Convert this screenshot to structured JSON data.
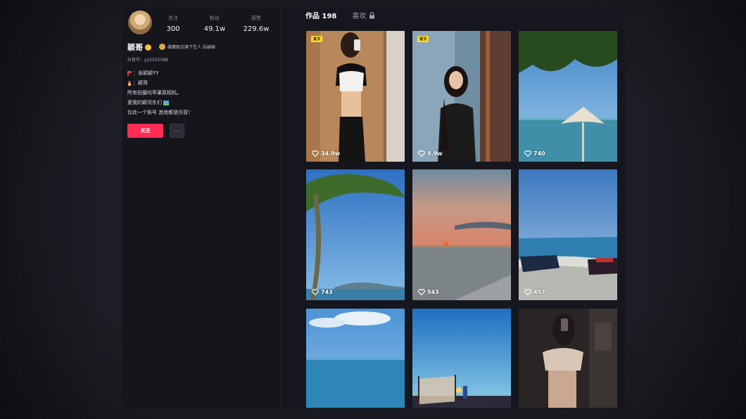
{
  "profile": {
    "stats": [
      {
        "label": "关注",
        "value": "300"
      },
      {
        "label": "粉丝",
        "value": "49.1w"
      },
      {
        "label": "获赞",
        "value": "229.6w"
      }
    ],
    "name": "颖哥",
    "signature": "雄鹰联合旗下艺人 张颖颖",
    "uid": "抖音号：yy5555588",
    "bio": [
      "：张颖颖YY",
      "：颖哥",
      "所有拍摄均苹果原相机。",
      "爱我的颖河东们",
      "仅此一个账号 其他都是仿冒！"
    ],
    "follow_label": "关注",
    "more_label": "···"
  },
  "tabs": [
    {
      "label": "作品 198",
      "active": true
    },
    {
      "label": "喜欢",
      "active": false
    }
  ],
  "videos": [
    {
      "pin": "置顶",
      "likes": "34.9w"
    },
    {
      "pin": "置顶",
      "likes": "9.9w"
    },
    {
      "pin": "",
      "likes": "740"
    },
    {
      "pin": "",
      "likes": "743"
    },
    {
      "pin": "",
      "likes": "543"
    },
    {
      "pin": "",
      "likes": "457"
    },
    {
      "pin": "",
      "likes": ""
    },
    {
      "pin": "",
      "likes": ""
    },
    {
      "pin": "",
      "likes": ""
    }
  ],
  "colors": {
    "accent": "#fe2c55",
    "pin_badge": "#ffdc24",
    "background": "#16161e"
  }
}
